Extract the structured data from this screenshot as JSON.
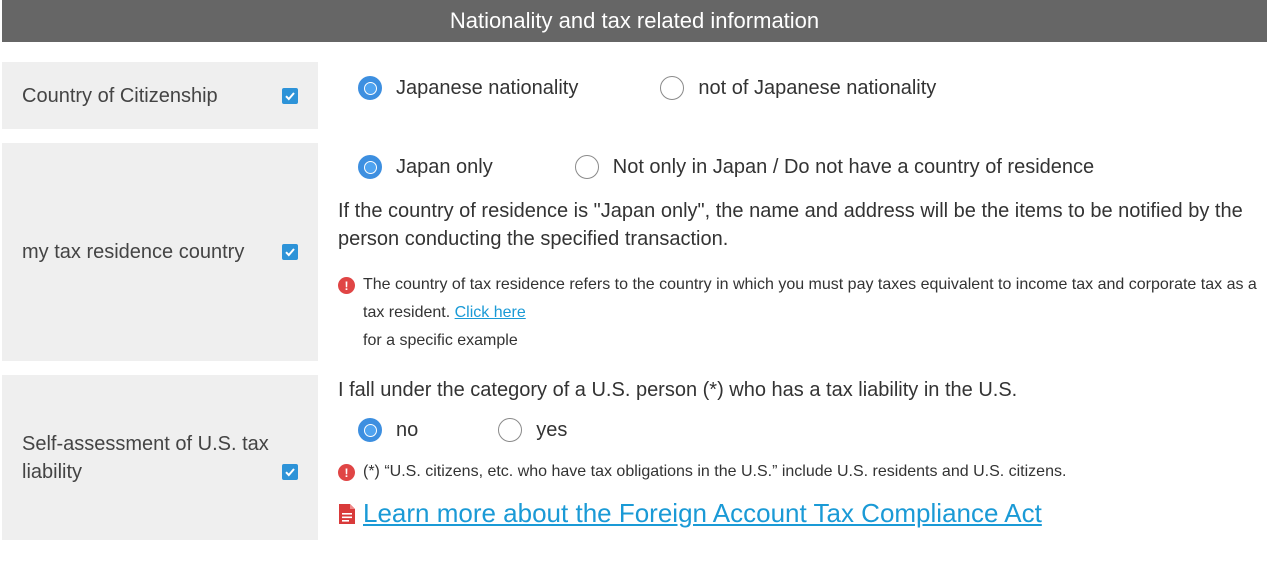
{
  "header": {
    "title": "Nationality and tax related information"
  },
  "citizenship": {
    "label": "Country of Citizenship",
    "options": [
      {
        "label": "Japanese nationality",
        "checked": true
      },
      {
        "label": "not of Japanese nationality",
        "checked": false
      }
    ]
  },
  "residence": {
    "label": "my tax residence country",
    "options": [
      {
        "label": "Japan only",
        "checked": true
      },
      {
        "label": "Not only in Japan / Do not have a country of residence",
        "checked": false
      }
    ],
    "paragraph": "If the country of residence is \"Japan only\", the name and address will be the items to be notified by the person conducting the specified transaction.",
    "note_text": "The country of tax residence refers to the country in which you must pay taxes equivalent to income tax and corporate tax as a tax resident.",
    "note_link": "Click here",
    "note_after": "for a specific example"
  },
  "us_tax": {
    "label": "Self-assessment of U.S. tax liability",
    "question": "I fall under the category of a U.S. person (*) who has a tax liability in the U.S.",
    "options": [
      {
        "label": "no",
        "checked": true
      },
      {
        "label": "yes",
        "checked": false
      }
    ],
    "note_text": "(*) “U.S. citizens, etc. who have tax obligations in the U.S.” include U.S. residents and U.S. citizens.",
    "fatca_link": "Learn more about the Foreign Account Tax Compliance Act"
  },
  "colors": {
    "header_bg": "#666666",
    "accent": "#2d93d8",
    "link": "#1a9ad6",
    "warning": "#e04545"
  }
}
